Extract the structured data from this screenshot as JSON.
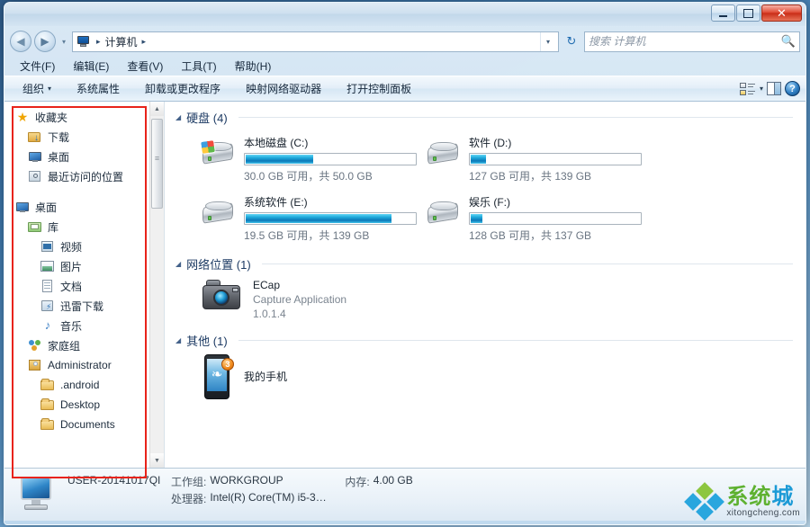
{
  "window": {
    "title": "计算机",
    "controls": {
      "minimize": "—",
      "maximize": "▢",
      "close": "✕"
    }
  },
  "address": {
    "back_glyph": "◀",
    "forward_glyph": "▶",
    "history_caret": "▾",
    "crumbs": [
      "计算机"
    ],
    "crumb_sep": "▸",
    "dropdown_caret": "▾",
    "refresh_glyph": "↻"
  },
  "search": {
    "placeholder": "搜索 计算机",
    "value": "",
    "icon": "search-icon"
  },
  "menubar": {
    "items": [
      {
        "label": "文件(F)"
      },
      {
        "label": "编辑(E)"
      },
      {
        "label": "查看(V)"
      },
      {
        "label": "工具(T)"
      },
      {
        "label": "帮助(H)"
      }
    ]
  },
  "toolbar": {
    "organize": "组织",
    "organize_caret": "▾",
    "items": [
      {
        "label": "系统属性"
      },
      {
        "label": "卸载或更改程序"
      },
      {
        "label": "映射网络驱动器"
      },
      {
        "label": "打开控制面板"
      }
    ],
    "views_caret": "▾",
    "help_glyph": "?"
  },
  "sidebar": {
    "items": [
      {
        "label": "收藏夹",
        "icon": "star-icon",
        "indent": 0
      },
      {
        "label": "下载",
        "icon": "downloads-folder-icon",
        "indent": 1
      },
      {
        "label": "桌面",
        "icon": "desktop-icon",
        "indent": 1
      },
      {
        "label": "最近访问的位置",
        "icon": "recent-places-icon",
        "indent": 1
      },
      {
        "label": "桌面",
        "icon": "desktop-icon",
        "indent": 0
      },
      {
        "label": "库",
        "icon": "library-folder-icon",
        "indent": 1
      },
      {
        "label": "视频",
        "icon": "video-icon",
        "indent": 2
      },
      {
        "label": "图片",
        "icon": "picture-icon",
        "indent": 2
      },
      {
        "label": "文档",
        "icon": "document-icon",
        "indent": 2
      },
      {
        "label": "迅雷下载",
        "icon": "thunder-download-icon",
        "indent": 2
      },
      {
        "label": "音乐",
        "icon": "music-note-icon",
        "indent": 2
      },
      {
        "label": "家庭组",
        "icon": "homegroup-icon",
        "indent": 1
      },
      {
        "label": "Administrator",
        "icon": "user-folder-icon",
        "indent": 1
      },
      {
        "label": ".android",
        "icon": "folder-icon",
        "indent": 2
      },
      {
        "label": "Desktop",
        "icon": "folder-icon",
        "indent": 2
      },
      {
        "label": "Documents",
        "icon": "folder-icon",
        "indent": 2
      }
    ],
    "scroll_up": "▲",
    "scroll_down": "▼"
  },
  "content": {
    "sections": [
      {
        "id": "hard-disks",
        "title": "硬盘 (4)",
        "caret": "◢"
      },
      {
        "id": "network-locations",
        "title": "网络位置 (1)",
        "caret": "◢"
      },
      {
        "id": "others",
        "title": "其他 (1)",
        "caret": "◢"
      }
    ],
    "drives": [
      {
        "name": "本地磁盘 (C:)",
        "size_text": "30.0 GB 可用，共 50.0 GB",
        "free_gb": 30.0,
        "total_gb": 50.0,
        "used_percent": 40,
        "bar_color": "#1fa9da",
        "is_system": true
      },
      {
        "name": "软件 (D:)",
        "size_text": "127 GB 可用，共 139 GB",
        "free_gb": 127,
        "total_gb": 139,
        "used_percent": 9,
        "bar_color": "#1fa9da",
        "is_system": false
      },
      {
        "name": "系统软件 (E:)",
        "size_text": "19.5 GB 可用，共 139 GB",
        "free_gb": 19.5,
        "total_gb": 139,
        "used_percent": 86,
        "bar_color": "#1fa9da",
        "is_system": false
      },
      {
        "name": "娱乐 (F:)",
        "size_text": "128 GB 可用，共 137 GB",
        "free_gb": 128,
        "total_gb": 137,
        "used_percent": 7,
        "bar_color": "#1fa9da",
        "is_system": false
      }
    ],
    "network_items": [
      {
        "name": "ECap",
        "description": "Capture Application",
        "version": "1.0.1.4",
        "icon": "camera-icon"
      }
    ],
    "other_items": [
      {
        "name": "我的手机",
        "icon": "phone-icon",
        "badge": "3"
      }
    ]
  },
  "statusbar": {
    "computer_name": "USER-20141017QI",
    "workgroup_label": "工作组:",
    "workgroup_value": "WORKGROUP",
    "memory_label": "内存:",
    "memory_value": "4.00 GB",
    "processor_label": "处理器:",
    "processor_value": "Intel(R) Core(TM) i5-3…"
  },
  "watermark": {
    "cn_green": "系统",
    "cn_blue": "城",
    "en": "xitongcheng.com"
  },
  "annotation": {
    "color": "#e8231a"
  }
}
